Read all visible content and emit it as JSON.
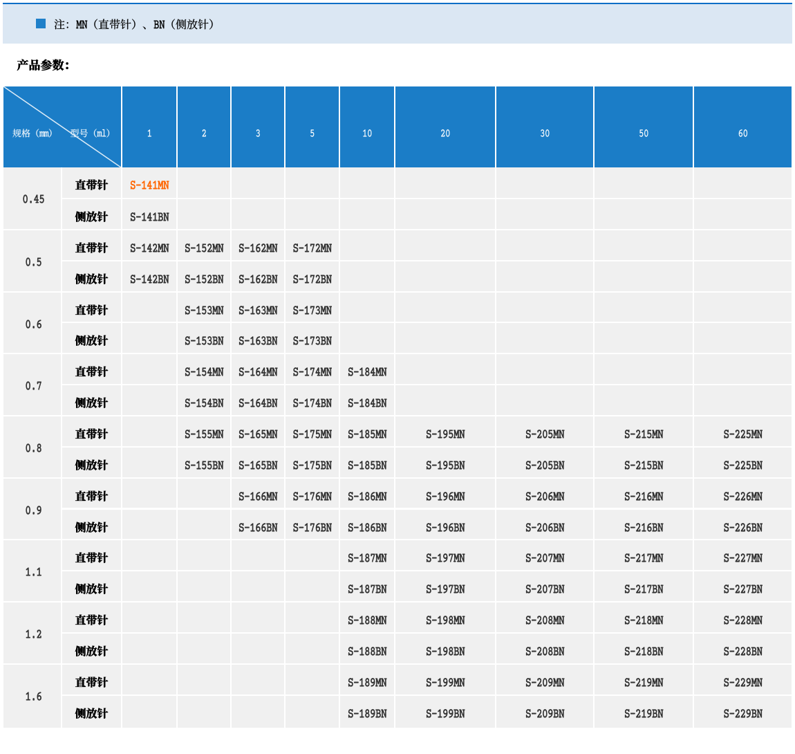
{
  "banner": {
    "icon": "blue-square-bullet",
    "text": "注：MN（直带针）、BN（侧放针）"
  },
  "section": {
    "title": "产品参数："
  },
  "table": {
    "corner": {
      "row_axis": "规格（mm）",
      "col_axis": "型号（ml）"
    },
    "columns": [
      "1",
      "2",
      "3",
      "5",
      "10",
      "20",
      "30",
      "50",
      "60"
    ],
    "row_labels": [
      "直带针",
      "侧放针"
    ],
    "highlighted_model": "S-141MN",
    "groups": [
      {
        "spec": "0.45",
        "mn": [
          "S-141MN",
          "",
          "",
          "",
          "",
          "",
          "",
          "",
          ""
        ],
        "bn": [
          "S-141BN",
          "",
          "",
          "",
          "",
          "",
          "",
          "",
          ""
        ]
      },
      {
        "spec": "0.5",
        "mn": [
          "S-142MN",
          "S-152MN",
          "S-162MN",
          "S-172MN",
          "",
          "",
          "",
          "",
          ""
        ],
        "bn": [
          "S-142BN",
          "S-152BN",
          "S-162BN",
          "S-172BN",
          "",
          "",
          "",
          "",
          ""
        ]
      },
      {
        "spec": "0.6",
        "mn": [
          "",
          "S-153MN",
          "S-163MN",
          "S-173MN",
          "",
          "",
          "",
          "",
          ""
        ],
        "bn": [
          "",
          "S-153BN",
          "S-163BN",
          "S-173BN",
          "",
          "",
          "",
          "",
          ""
        ]
      },
      {
        "spec": "0.7",
        "mn": [
          "",
          "S-154MN",
          "S-164MN",
          "S-174MN",
          "S-184MN",
          "",
          "",
          "",
          ""
        ],
        "bn": [
          "",
          "S-154BN",
          "S-164BN",
          "S-174BN",
          "S-184BN",
          "",
          "",
          "",
          ""
        ]
      },
      {
        "spec": "0.8",
        "mn": [
          "",
          "S-155MN",
          "S-165MN",
          "S-175MN",
          "S-185MN",
          "S-195MN",
          "S-205MN",
          "S-215MN",
          "S-225MN"
        ],
        "bn": [
          "",
          "S-155BN",
          "S-165BN",
          "S-175BN",
          "S-185BN",
          "S-195BN",
          "S-205BN",
          "S-215BN",
          "S-225BN"
        ]
      },
      {
        "spec": "0.9",
        "mn": [
          "",
          "",
          "S-166MN",
          "S-176MN",
          "S-186MN",
          "S-196MN",
          "S-206MN",
          "S-216MN",
          "S-226MN"
        ],
        "bn": [
          "",
          "",
          "S-166BN",
          "S-176BN",
          "S-186BN",
          "S-196BN",
          "S-206BN",
          "S-216BN",
          "S-226BN"
        ]
      },
      {
        "spec": "1.1",
        "mn": [
          "",
          "",
          "",
          "",
          "S-187MN",
          "S-197MN",
          "S-207MN",
          "S-217MN",
          "S-227MN"
        ],
        "bn": [
          "",
          "",
          "",
          "",
          "S-187BN",
          "S-197BN",
          "S-207BN",
          "S-217BN",
          "S-227BN"
        ]
      },
      {
        "spec": "1.2",
        "mn": [
          "",
          "",
          "",
          "",
          "S-188MN",
          "S-198MN",
          "S-208MN",
          "S-218MN",
          "S-228MN"
        ],
        "bn": [
          "",
          "",
          "",
          "",
          "S-188BN",
          "S-198BN",
          "S-208BN",
          "S-218BN",
          "S-228BN"
        ]
      },
      {
        "spec": "1.6",
        "mn": [
          "",
          "",
          "",
          "",
          "S-189MN",
          "S-199MN",
          "S-209MN",
          "S-219MN",
          "S-229MN"
        ],
        "bn": [
          "",
          "",
          "",
          "",
          "S-189BN",
          "S-199BN",
          "S-209BN",
          "S-219BN",
          "S-229BN"
        ]
      }
    ]
  },
  "colors": {
    "top_line": "#0d6ec6",
    "banner_bg": "#dbe7f3",
    "bullet": "#1f80c9",
    "header_bg": "#1b7dc7",
    "body_bg": "#f0f0f0",
    "grid": "#ffffff",
    "code_text": "#303030",
    "cjk_text": "#000000",
    "link": "#ff6600",
    "header_text": "#ffffff"
  }
}
